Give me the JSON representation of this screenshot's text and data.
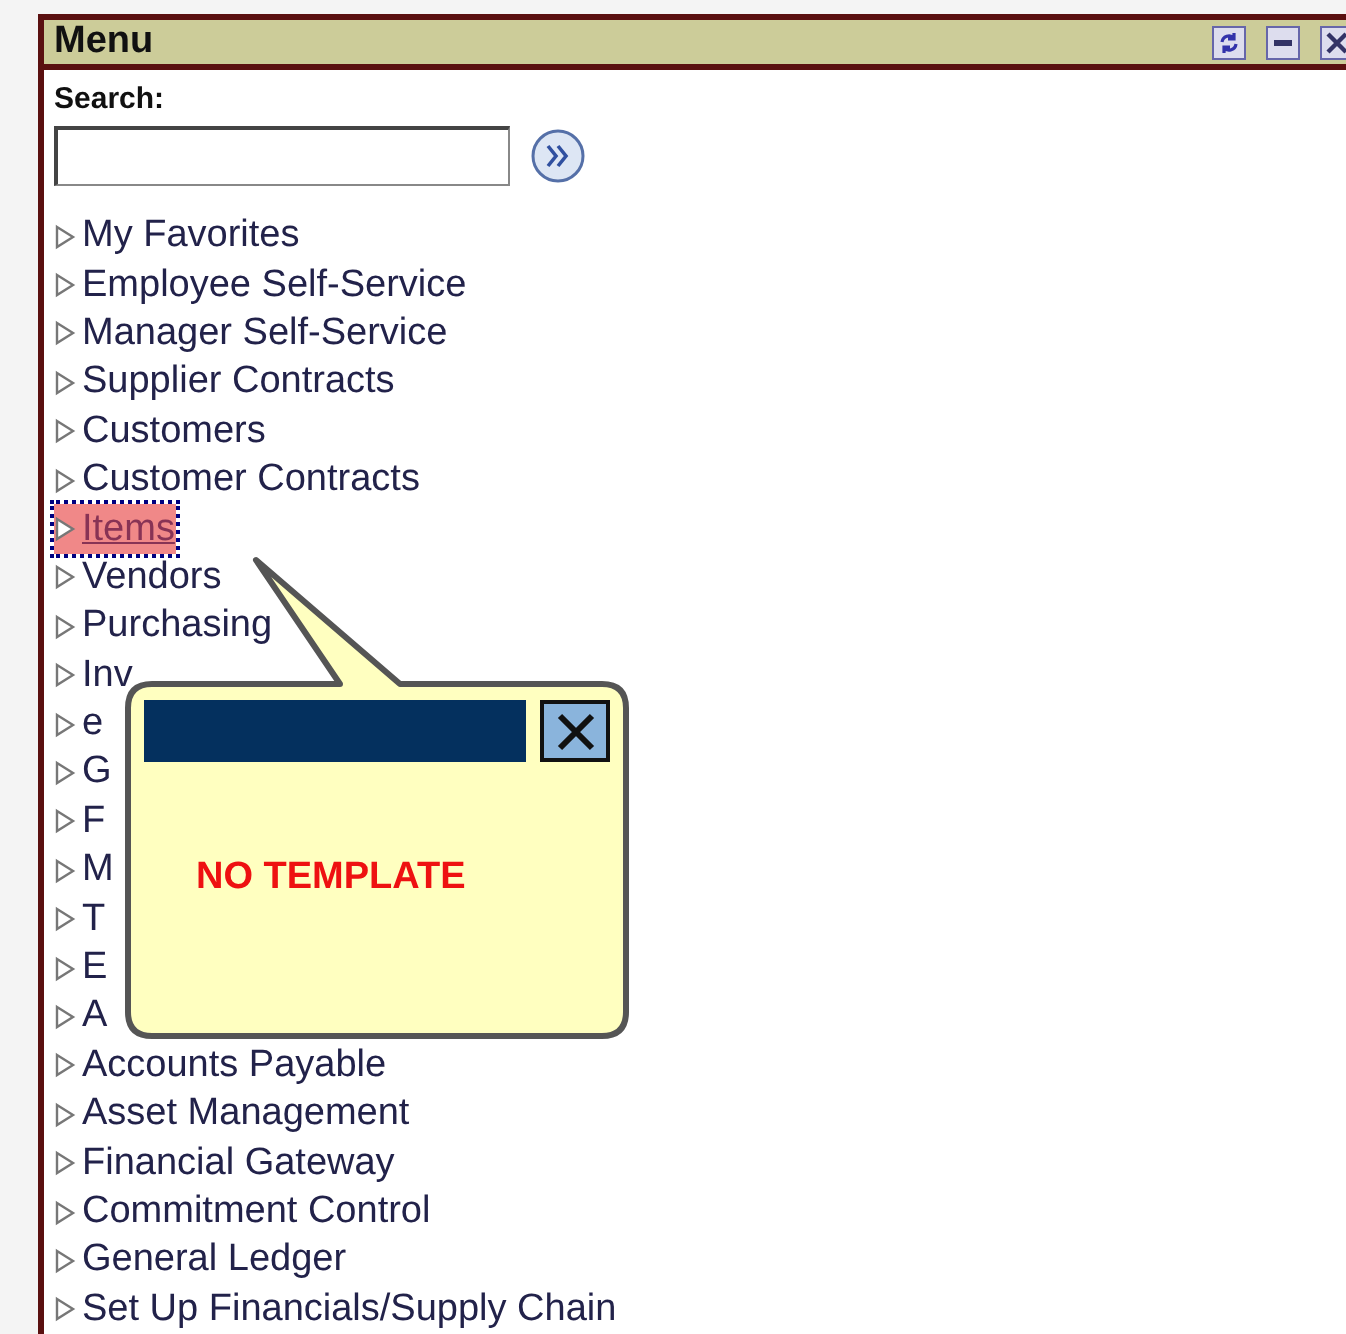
{
  "panel": {
    "title": "Menu"
  },
  "search": {
    "label": "Search:"
  },
  "menu_items": [
    {
      "label": "My Favorites",
      "selected": false
    },
    {
      "label": "Employee Self-Service",
      "selected": false
    },
    {
      "label": "Manager Self-Service",
      "selected": false
    },
    {
      "label": "Supplier Contracts",
      "selected": false
    },
    {
      "label": "Customers",
      "selected": false
    },
    {
      "label": "Customer Contracts",
      "selected": false
    },
    {
      "label": "Items",
      "selected": true
    },
    {
      "label": "Vendors",
      "selected": false
    },
    {
      "label": "Purchasing",
      "selected": false
    },
    {
      "label": "Inv",
      "selected": false
    },
    {
      "label": "e",
      "selected": false
    },
    {
      "label": "G",
      "selected": false
    },
    {
      "label": "F",
      "selected": false
    },
    {
      "label": "M",
      "selected": false
    },
    {
      "label": "T",
      "selected": false
    },
    {
      "label": "E",
      "selected": false
    },
    {
      "label": "A",
      "selected": false
    },
    {
      "label": "Accounts Payable",
      "selected": false
    },
    {
      "label": "Asset Management",
      "selected": false
    },
    {
      "label": "Financial Gateway",
      "selected": false
    },
    {
      "label": "Commitment Control",
      "selected": false
    },
    {
      "label": "General Ledger",
      "selected": false
    },
    {
      "label": "Set Up Financials/Supply Chain",
      "selected": false
    }
  ],
  "callout": {
    "message": "NO TEMPLATE"
  }
}
